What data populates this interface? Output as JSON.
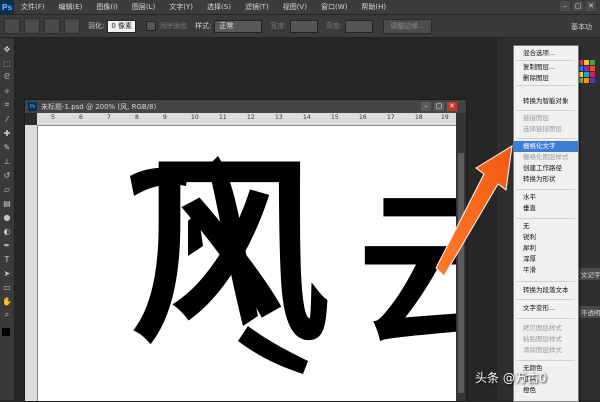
{
  "app": {
    "logo": "Ps",
    "menu": [
      "文件(F)",
      "编辑(E)",
      "图像(I)",
      "图层(L)",
      "文字(Y)",
      "选择(S)",
      "滤镜(T)",
      "视图(V)",
      "窗口(W)",
      "帮助(H)"
    ],
    "window_controls": [
      "–",
      "▢",
      "✕"
    ]
  },
  "options_bar": {
    "feather_label": "羽化:",
    "feather_value": "0 像素",
    "antialias_label": "消除锯齿",
    "style_label": "样式:",
    "style_value": "正常",
    "width_label": "宽度:",
    "height_label": "高度:",
    "refine_edge_label": "调整边缘...",
    "workspace_label": "基本功"
  },
  "document": {
    "title": "未标题-1.psd @ 200% (风, RGB/8)",
    "ruler_marks": [
      "5",
      "6",
      "7",
      "8",
      "9",
      "10",
      "11",
      "12",
      "13",
      "14",
      "15",
      "16",
      "17",
      "18",
      "19"
    ],
    "canvas_text_1": "风",
    "canvas_text_2": "云"
  },
  "context_menu": {
    "items": [
      {
        "label": "混合选项...",
        "enabled": true
      },
      {
        "label": "复制图层...",
        "enabled": true
      },
      {
        "label": "删除图层",
        "enabled": true
      },
      {
        "label": "转换为智能对象",
        "enabled": true
      },
      {
        "label": "链接图层",
        "enabled": false
      },
      {
        "label": "选择链接图层",
        "enabled": false
      },
      {
        "label": "栅格化文字",
        "enabled": true,
        "highlighted": true
      },
      {
        "label": "栅格化图层样式",
        "enabled": false
      },
      {
        "label": "创建工作路径",
        "enabled": true
      },
      {
        "label": "转换为形状",
        "enabled": true
      },
      {
        "label": "水平",
        "enabled": true
      },
      {
        "label": "垂直",
        "enabled": true
      },
      {
        "label": "无",
        "enabled": true
      },
      {
        "label": "锐利",
        "enabled": true
      },
      {
        "label": "犀利",
        "enabled": true
      },
      {
        "label": "浑厚",
        "enabled": true
      },
      {
        "label": "平滑",
        "enabled": true
      },
      {
        "label": "转换为段落文本",
        "enabled": true
      },
      {
        "label": "文字变形...",
        "enabled": true
      },
      {
        "label": "拷贝图层样式",
        "enabled": false
      },
      {
        "label": "粘贴图层样式",
        "enabled": false
      },
      {
        "label": "清除图层样式",
        "enabled": false
      },
      {
        "label": "无颜色",
        "enabled": true
      },
      {
        "label": "红色",
        "enabled": true
      },
      {
        "label": "橙色",
        "enabled": true
      }
    ]
  },
  "right_panel": {
    "tab_1": "文记字",
    "tab_2": "不透明"
  },
  "colors": {
    "highlight": "#3d7dd6",
    "arrow": "#f26a1f",
    "menu_bg": "#f0f0f0"
  },
  "watermark": "头条 @万古0"
}
